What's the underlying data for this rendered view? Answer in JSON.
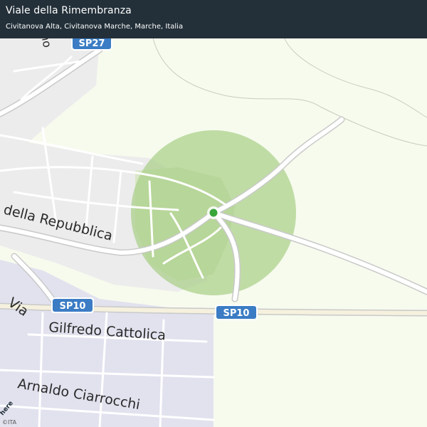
{
  "header": {
    "title": "Viale della Rimembranza",
    "subtitle": "Civitanova Alta, Civitanova Marche, Marche, Italia"
  },
  "map": {
    "road_shields": {
      "sp27": "SP27",
      "sp10_left": "SP10",
      "sp10_right": "SP10"
    },
    "street_labels": {
      "repubblica": "della Repubblica",
      "gilfredo": "Gilfredo Cattolica",
      "via": "Via",
      "ciarrocchi": "Arnaldo Ciarrocchi",
      "partial_top": "no"
    },
    "accuracy_radius_color": "#b9d99c",
    "location_marker_color": "#3aa63a",
    "shield_color": "#3b7cc4"
  },
  "attribution": {
    "copyright": "©ITA",
    "logo": "here"
  }
}
